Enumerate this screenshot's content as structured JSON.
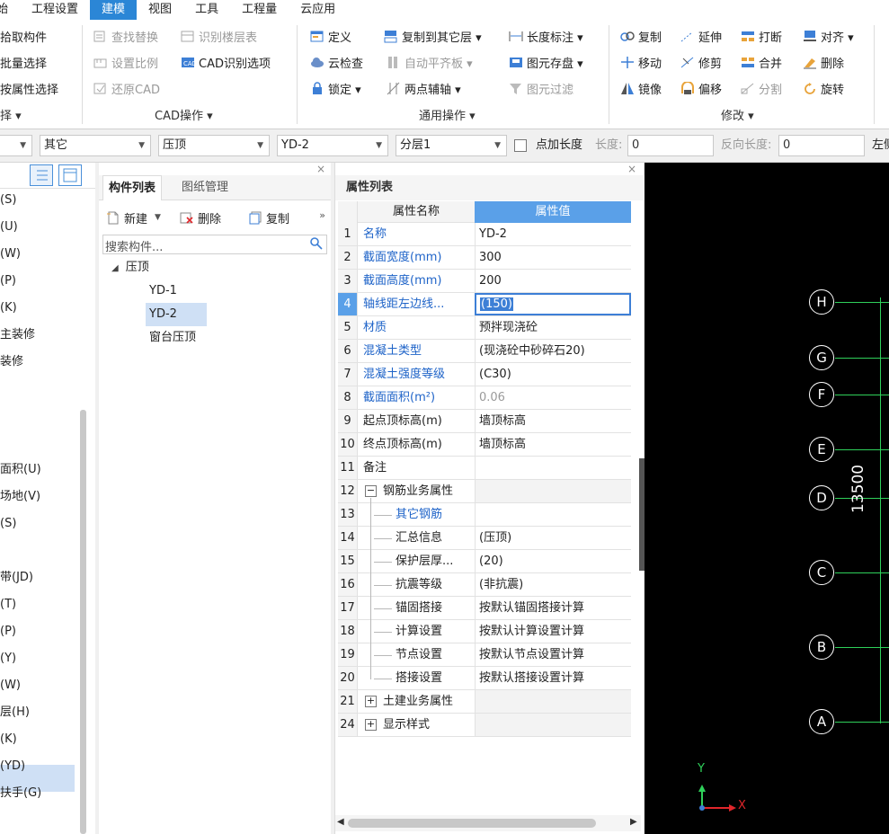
{
  "menubar": [
    "始",
    "工程设置",
    "建模",
    "视图",
    "工具",
    "工程量",
    "云应用"
  ],
  "ribbon": {
    "left_col": [
      "拾取构件",
      "批量选择",
      "按属性选择"
    ],
    "left_group_label": "择 ▾",
    "cad_group": {
      "items": [
        "查找替换",
        "识别楼层表",
        "设置比例",
        "CAD识别选项",
        "还原CAD"
      ],
      "label": "CAD操作 ▾"
    },
    "general_group": {
      "items": [
        "定义",
        "复制到其它层 ▾",
        "长度标注 ▾",
        "云检查",
        "自动平齐板 ▾",
        "图元存盘 ▾",
        "锁定 ▾",
        "两点辅轴 ▾",
        "图元过滤"
      ],
      "label": "通用操作 ▾"
    },
    "modify_group": {
      "items": [
        "复制",
        "延伸",
        "打断",
        "对齐 ▾",
        "移动",
        "修剪",
        "合并",
        "删除",
        "镜像",
        "偏移",
        "分割",
        "旋转"
      ],
      "label": "修改 ▾"
    }
  },
  "filterbar": {
    "dd1": "",
    "dd2": "其它",
    "dd3": "压顶",
    "dd4": "YD-2",
    "dd5": "分层1",
    "add_length_label": "点加长度",
    "length_label": "长度:",
    "length_value": "0",
    "reverse_length_label": "反向长度:",
    "reverse_length_value": "0",
    "left_label": "左侧"
  },
  "left_panel": {
    "items": [
      "(S)",
      "(U)",
      "(W)",
      "(P)",
      "(K)",
      "主装修",
      "装修",
      "",
      "",
      "",
      "面积(U)",
      "场地(V)",
      "(S)",
      "",
      "带(JD)",
      "(T)",
      "(P)",
      "(Y)",
      "(W)",
      "层(H)",
      "(K)",
      "(YD)",
      "扶手(G)"
    ]
  },
  "component_panel": {
    "tab_list": "构件列表",
    "tab_drawing": "图纸管理",
    "new_label": "新建",
    "delete_label": "删除",
    "copy_label": "复制",
    "search_placeholder": "搜索构件...",
    "tree_root": "压顶",
    "tree_items": [
      "YD-1",
      "YD-2",
      "窗台压顶"
    ]
  },
  "property_panel": {
    "title": "属性列表",
    "col_name": "属性名称",
    "col_value": "属性值",
    "rows": [
      {
        "num": "1",
        "name": "名称",
        "value": "YD-2"
      },
      {
        "num": "2",
        "name": "截面宽度(mm)",
        "value": "300"
      },
      {
        "num": "3",
        "name": "截面高度(mm)",
        "value": "200"
      },
      {
        "num": "4",
        "name": "轴线距左边线...",
        "value": "(150)"
      },
      {
        "num": "5",
        "name": "材质",
        "value": "预拌现浇砼"
      },
      {
        "num": "6",
        "name": "混凝土类型",
        "value": "(现浇砼中砂碎石20)"
      },
      {
        "num": "7",
        "name": "混凝土强度等级",
        "value": "(C30)"
      },
      {
        "num": "8",
        "name": "截面面积(m²)",
        "value": "0.06"
      },
      {
        "num": "9",
        "name": "起点顶标高(m)",
        "value": "墙顶标高"
      },
      {
        "num": "10",
        "name": "终点顶标高(m)",
        "value": "墙顶标高"
      },
      {
        "num": "11",
        "name": "备注",
        "value": ""
      },
      {
        "num": "12",
        "name": "钢筋业务属性",
        "value": ""
      },
      {
        "num": "13",
        "name": "其它钢筋",
        "value": ""
      },
      {
        "num": "14",
        "name": "汇总信息",
        "value": "(压顶)"
      },
      {
        "num": "15",
        "name": "保护层厚...",
        "value": "(20)"
      },
      {
        "num": "16",
        "name": "抗震等级",
        "value": "(非抗震)"
      },
      {
        "num": "17",
        "name": "锚固搭接",
        "value": "按默认锚固搭接计算"
      },
      {
        "num": "18",
        "name": "计算设置",
        "value": "按默认计算设置计算"
      },
      {
        "num": "19",
        "name": "节点设置",
        "value": "按默认节点设置计算"
      },
      {
        "num": "20",
        "name": "搭接设置",
        "value": "按默认搭接设置计算"
      },
      {
        "num": "21",
        "name": "土建业务属性",
        "value": ""
      },
      {
        "num": "24",
        "name": "显示样式",
        "value": ""
      }
    ]
  },
  "canvas": {
    "axes": [
      "H",
      "G",
      "F",
      "E",
      "D",
      "C",
      "B",
      "A"
    ],
    "dimension": "13500",
    "ucs_x": "X",
    "ucs_y": "Y",
    "colors": {
      "background": "#000000",
      "axis_line": "#2fd05a",
      "ucs_x": "#e0262b",
      "ucs_y": "#2fd05a"
    }
  }
}
